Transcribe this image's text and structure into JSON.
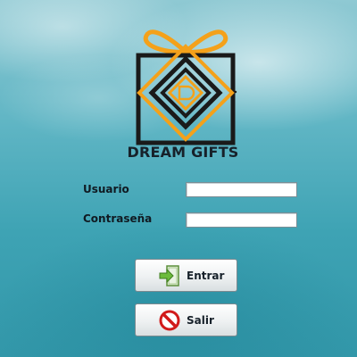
{
  "brand": {
    "name": "DREAM GIFTS",
    "logo_icon": "gift-box-logo",
    "colors": {
      "ribbon": "#f4a11a",
      "frame": "#1a1a1a"
    }
  },
  "login": {
    "username_label": "Usuario",
    "username_value": "",
    "password_label": "Contraseña",
    "password_value": ""
  },
  "buttons": {
    "enter_label": "Entrar",
    "enter_icon": "login-arrow-icon",
    "exit_label": "Salir",
    "exit_icon": "no-entry-icon"
  }
}
